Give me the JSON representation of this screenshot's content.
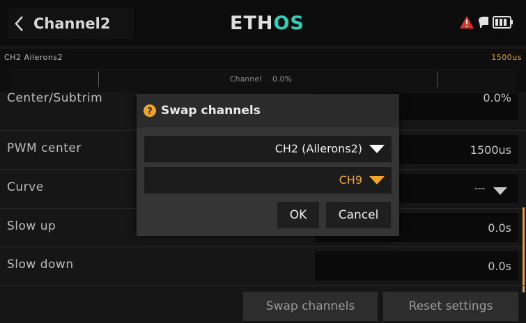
{
  "header": {
    "title": "Channel2",
    "logo_part1": "ETH",
    "logo_part2": "OS"
  },
  "monitor": {
    "channel_name": "CH2 Ailerons2",
    "output_us": "1500us",
    "label": "Channel",
    "value": "0.0%"
  },
  "rows": {
    "center_label": "Center/Subtrim",
    "center_value": "0.0%",
    "pwm_label": "PWM center",
    "pwm_value": "1500us",
    "curve_label": "Curve",
    "curve_value": "---",
    "slow_up_label": "Slow up",
    "slow_up_value": "0.0s",
    "slow_down_label": "Slow down",
    "slow_down_value": "0.0s"
  },
  "actions": {
    "swap_label": "Swap channels",
    "reset_label": "Reset settings"
  },
  "modal": {
    "title": "Swap channels",
    "source_value": "CH2 (Ailerons2)",
    "target_value": "CH9",
    "ok_label": "OK",
    "cancel_label": "Cancel"
  },
  "icons": {
    "back": "chevron-left-icon",
    "warning": "warning-icon",
    "rf": "rf-signal-icon",
    "battery": "battery-icon",
    "help": "help-icon",
    "dropdown": "chevron-down-icon"
  },
  "colors": {
    "accent": "#f0a52a",
    "logo_accent": "#2fd0b9",
    "warning": "#d9342b"
  }
}
